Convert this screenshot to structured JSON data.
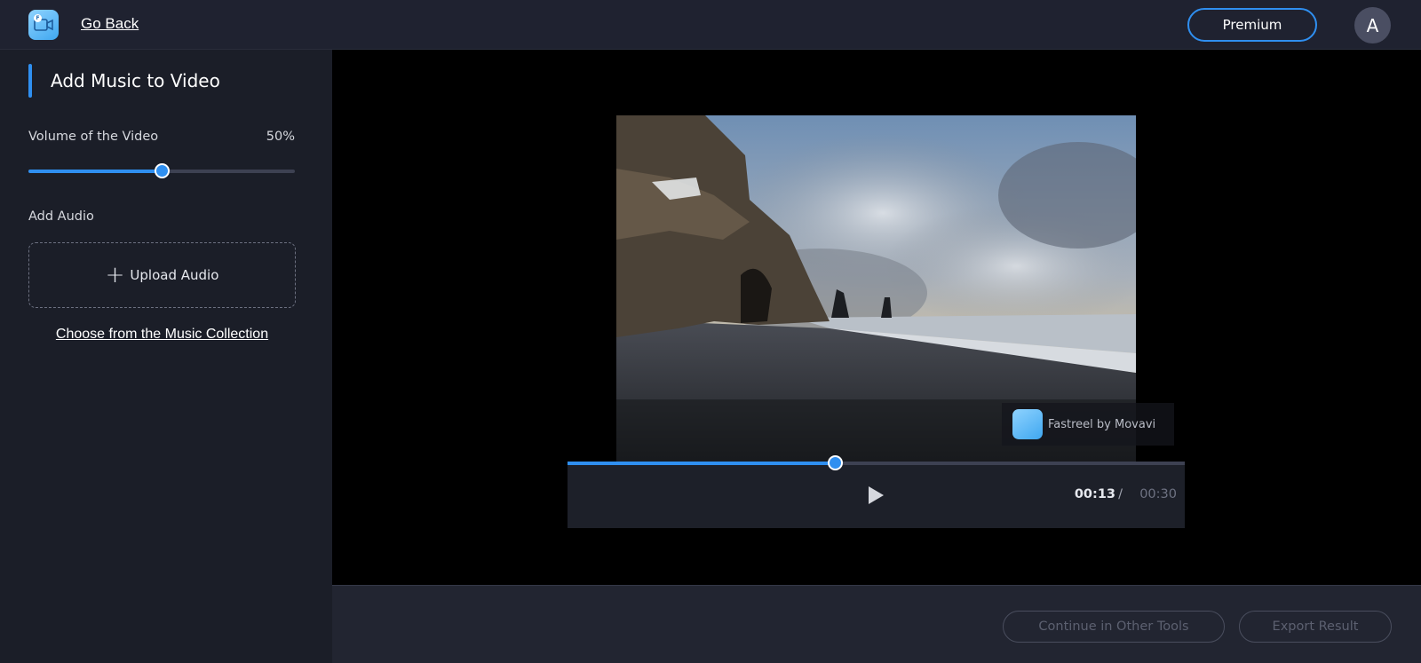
{
  "header": {
    "logo_icon": "fastreel-logo-icon",
    "go_back_label": "Go Back",
    "premium_label": "Premium",
    "avatar_initial": "A"
  },
  "sidebar": {
    "title": "Add Music to Video",
    "volume_label": "Volume of the Video",
    "volume_value_text": "50%",
    "volume_level": 0.5,
    "add_audio_label": "Add Audio",
    "upload_icon": "plus-icon",
    "upload_label": "Upload Audio",
    "music_collection_link": "Choose from the Music Collection"
  },
  "player": {
    "watermark_text": "Fastreel by Movavi",
    "progress_level": 0.433,
    "play_icon": "play-icon",
    "time_current": "00:13",
    "time_separator": "/",
    "time_total": "00:30"
  },
  "footer": {
    "continue_label": "Continue in Other Tools",
    "export_label": "Export Result"
  },
  "colors": {
    "accent": "#2f8ff0",
    "background": "#1b1e28",
    "video_area": "#000000"
  }
}
